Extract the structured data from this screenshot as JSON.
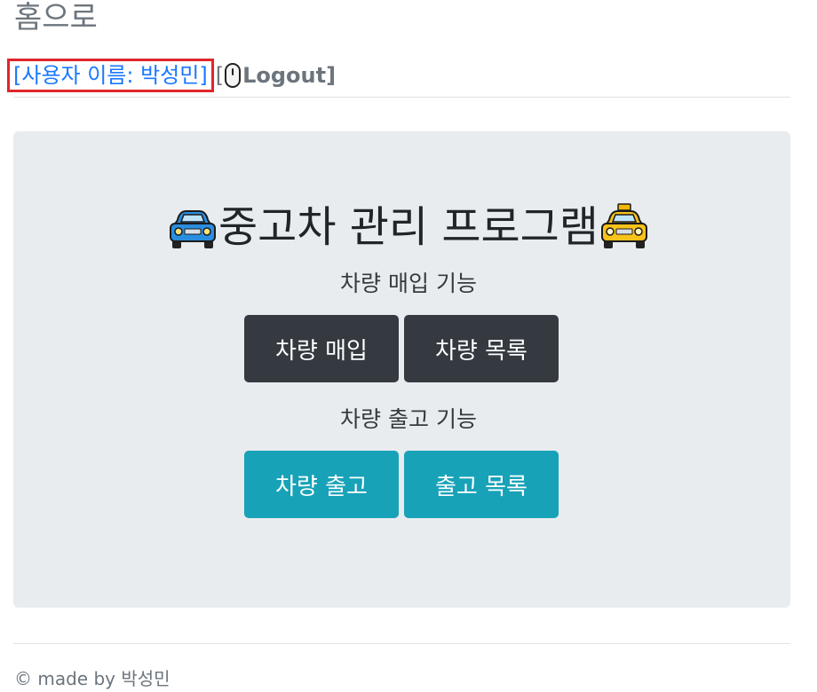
{
  "nav": {
    "home_label": "홈으로"
  },
  "user": {
    "name_text": "[사용자 이름: 박성민]",
    "logout_open": "[",
    "logout_label": "Logout]"
  },
  "main": {
    "title": "중고차 관리 프로그램",
    "buy_section_label": "차량 매입 기능",
    "out_section_label": "차량 출고 기능",
    "buttons": {
      "buy": "차량 매입",
      "buy_list": "차량 목록",
      "out": "차량 출고",
      "out_list": "출고 목록"
    }
  },
  "footer": {
    "text": "© made by 박성민"
  },
  "icons": {
    "left": "blue-car-icon",
    "right": "taxi-icon",
    "logout": "mouse-icon"
  },
  "colors": {
    "primary_text": "#1a78ff",
    "highlight_border": "#e0262b",
    "button_dark": "#343a40",
    "button_info": "#17a2b8",
    "jumbotron_bg": "#e9ecef"
  }
}
